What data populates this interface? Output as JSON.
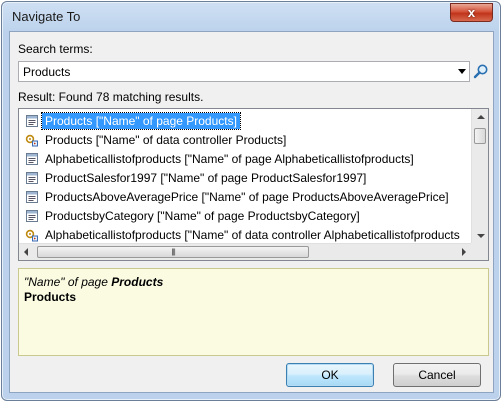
{
  "window": {
    "title": "Navigate To",
    "close_glyph": "x"
  },
  "search": {
    "label": "Search terms:",
    "value": "Products",
    "dropdown_icon": "chevron-down-icon",
    "button_icon": "search-icon"
  },
  "result": {
    "text": "Result: Found 78 matching results."
  },
  "results": [
    {
      "icon": "page-icon",
      "label": "Products [\"Name\" of page Products]",
      "selected": true
    },
    {
      "icon": "data-controller-icon",
      "label": "Products [\"Name\" of data controller Products]",
      "selected": false
    },
    {
      "icon": "page-icon",
      "label": "Alphabeticallistofproducts [\"Name\" of page Alphabeticallistofproducts]",
      "selected": false
    },
    {
      "icon": "page-icon",
      "label": "ProductSalesfor1997 [\"Name\" of page ProductSalesfor1997]",
      "selected": false
    },
    {
      "icon": "page-icon",
      "label": "ProductsAboveAveragePrice [\"Name\" of page ProductsAboveAveragePrice]",
      "selected": false
    },
    {
      "icon": "page-icon",
      "label": "ProductsbyCategory [\"Name\" of page ProductsbyCategory]",
      "selected": false
    },
    {
      "icon": "data-controller-icon",
      "label": "Alphabeticallistofproducts [\"Name\" of data controller Alphabeticallistofproducts",
      "selected": false
    }
  ],
  "details": {
    "line1_prefix": "\"Name\" of page ",
    "line1_name": "Products",
    "line2": "Products"
  },
  "buttons": {
    "ok": "OK",
    "cancel": "Cancel"
  },
  "colors": {
    "selection": "#3399ff",
    "details_bg": "#fbfbe2",
    "titlebar": "#bcd2ec",
    "close": "#c0341a"
  }
}
